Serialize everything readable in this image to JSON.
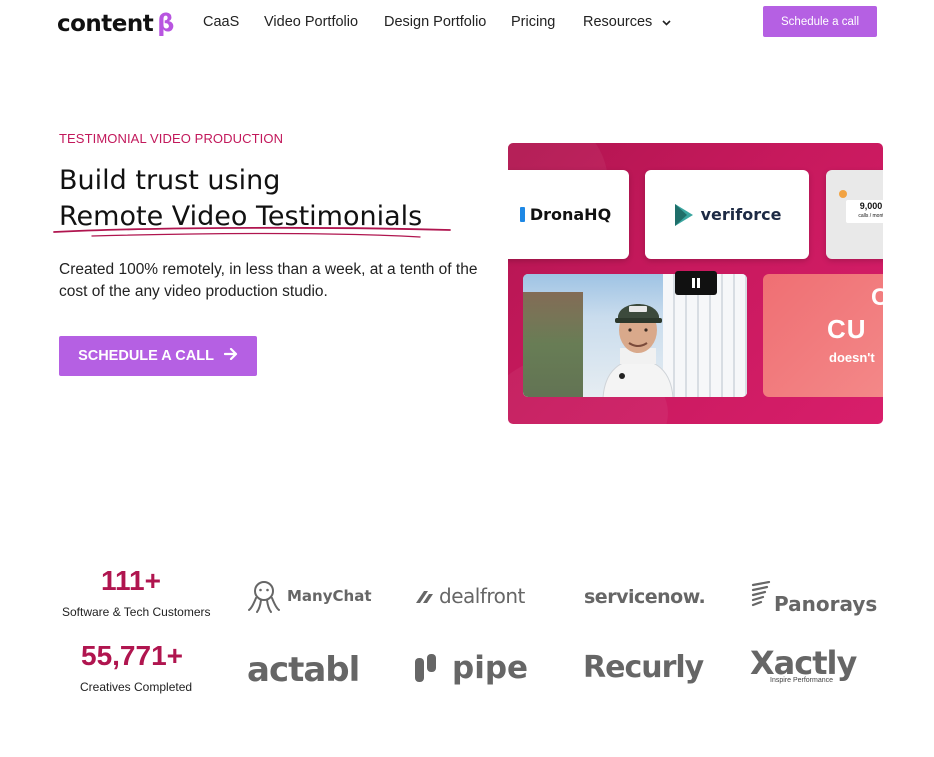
{
  "nav": {
    "logo_text": "content",
    "logo_mark": "β",
    "items": [
      {
        "label": "CaaS"
      },
      {
        "label": "Video Portfolio"
      },
      {
        "label": "Design Portfolio"
      },
      {
        "label": "Pricing"
      },
      {
        "label": "Resources"
      }
    ],
    "cta_label": "Schedule a call"
  },
  "hero": {
    "eyebrow": "TESTIMONIAL VIDEO PRODUCTION",
    "title_line1": "Build trust using",
    "title_line2": "Remote Video Testimonials",
    "lead": "Created 100% remotely, in less than a week, at a tenth of the cost of the any video production studio.",
    "cta_label": "SCHEDULE A CALL"
  },
  "video": {
    "card1": "DronaHQ",
    "card2": "veriforce",
    "card3_value": "9,000",
    "card3_caption": "calls / mont",
    "promo_line1": "C",
    "promo_line2": "CU",
    "promo_line3": "doesn't",
    "pause_icon": "pause-icon"
  },
  "stats": [
    {
      "value": "111+",
      "label": "Software & Tech Customers"
    },
    {
      "value": "55,771+",
      "label": "Creatives Completed"
    }
  ],
  "logos": [
    {
      "name": "ManyChat"
    },
    {
      "name": "dealfront"
    },
    {
      "name": "servicenow."
    },
    {
      "name": "Panorays"
    },
    {
      "name": "actabl"
    },
    {
      "name": "pipe"
    },
    {
      "name": "Recurly"
    },
    {
      "name": "Xactly",
      "tagline": "Inspire Performance"
    }
  ],
  "colors": {
    "accent": "#b560e3",
    "brand_red": "#c2185b",
    "stat": "#b0154f"
  }
}
